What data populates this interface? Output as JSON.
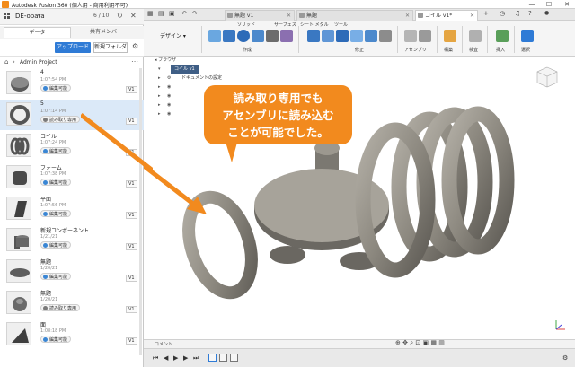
{
  "titlebar": {
    "title": "Autodesk Fusion 360 (個人用 - 商用利用不可)",
    "minimize": "—",
    "maximize": "☐",
    "close": "✕"
  },
  "data_panel": {
    "user": "DE-obara",
    "counter": "6 / 10",
    "tabs": [
      "データ",
      "共有メンバー"
    ],
    "upload_label": "アップロード",
    "new_folder_label": "新規フォルダ",
    "project_name": "Admin Project",
    "files": [
      {
        "name": "4",
        "date": "1:07:54 PM",
        "status": "編集可能",
        "version": "V1"
      },
      {
        "name": "5",
        "date": "1:07:14 PM",
        "status": "読み取り専用",
        "version": "V1"
      },
      {
        "name": "コイル",
        "date": "1:07:24 PM",
        "status": "編集可能",
        "version": "V1"
      },
      {
        "name": "フォーム",
        "date": "1:07:38 PM",
        "status": "編集可能",
        "version": "V1"
      },
      {
        "name": "平面",
        "date": "1:07:56 PM",
        "status": "編集可能",
        "version": "V1"
      },
      {
        "name": "新規コンポーネント",
        "date": "1/21/21",
        "status": "編集可能",
        "version": "V1"
      },
      {
        "name": "無題",
        "date": "1/20/21",
        "status": "編集可能",
        "version": "V1"
      },
      {
        "name": "無題",
        "date": "1/20/21",
        "status": "読み取り専用",
        "version": "V1"
      },
      {
        "name": "面",
        "date": "1:08:18 PM",
        "status": "編集可能",
        "version": "V1"
      }
    ]
  },
  "doc_tabs": [
    {
      "label": "無題 v1"
    },
    {
      "label": "無題"
    },
    {
      "label": "コイル v1*"
    }
  ],
  "toolbar": {
    "design_label": "デザイン",
    "sections": [
      "ソリッド",
      "サーフェス",
      "シート メタル",
      "ツール"
    ],
    "groups": [
      "作成",
      "修正",
      "アセンブリ",
      "構築",
      "検査",
      "挿入",
      "選択"
    ]
  },
  "browser": {
    "header": "ブラウザ",
    "root": "コイル v1",
    "rows": [
      "ドキュメントの設定"
    ]
  },
  "callout": {
    "lines": [
      "読み取り専用でも",
      "アセンブリに読み込む",
      "ことが可能でした。"
    ],
    "color": "#f28a1e"
  },
  "comment_label": "コメント",
  "colors": {
    "accent": "#2f7bd6",
    "callout": "#f28a1e",
    "model": "#8f8b83"
  }
}
